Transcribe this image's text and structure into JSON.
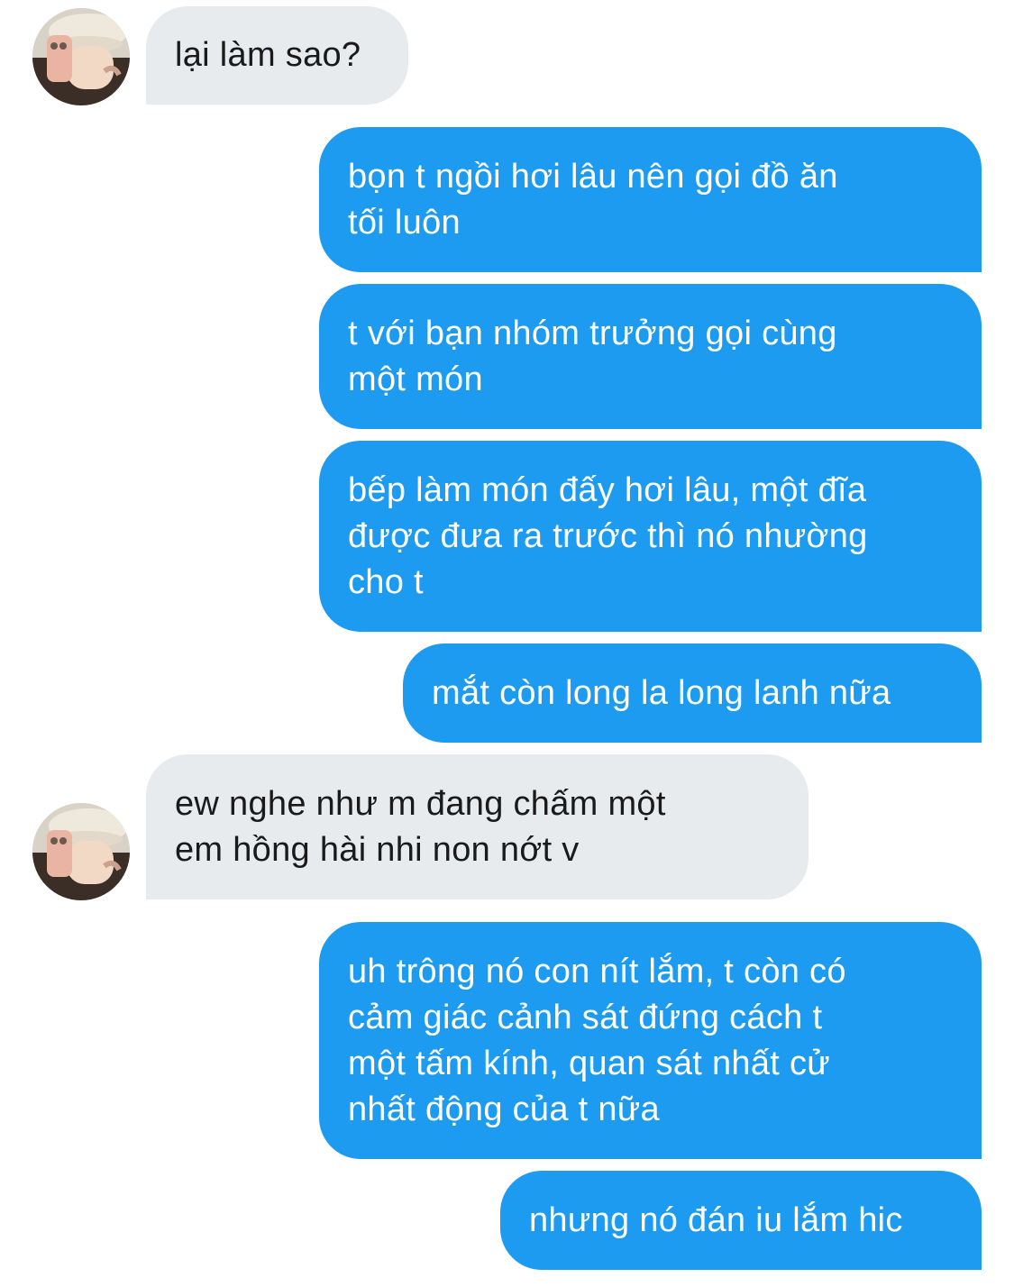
{
  "conversation": {
    "avatar_icon": "user-avatar-photo",
    "colors": {
      "incoming_bubble": "#e8ebee",
      "outgoing_bubble": "#1d9bf0",
      "incoming_text": "#1a1a1a",
      "outgoing_text": "#ffffff"
    },
    "messages": [
      {
        "direction": "incoming",
        "text": "lại làm sao?"
      },
      {
        "direction": "outgoing",
        "text": "bọn t ngồi hơi lâu nên gọi đồ ăn\ntối luôn"
      },
      {
        "direction": "outgoing",
        "text": "t với bạn nhóm trưởng gọi cùng\nmột món"
      },
      {
        "direction": "outgoing",
        "text": "bếp làm món đấy hơi lâu, một đĩa\nđược đưa ra trước thì nó nhường\ncho t"
      },
      {
        "direction": "outgoing",
        "text": "mắt còn long la long lanh nữa"
      },
      {
        "direction": "incoming",
        "text": "ew nghe như m đang chấm một\nem hồng hài nhi non nớt v"
      },
      {
        "direction": "outgoing",
        "text": "uh trông nó con nít lắm, t còn có\ncảm giác cảnh sát đứng cách t\nmột tấm kính, quan sát nhất cử\nnhất động của t nữa"
      },
      {
        "direction": "outgoing",
        "text": "nhưng nó đán iu lắm hic"
      }
    ]
  }
}
